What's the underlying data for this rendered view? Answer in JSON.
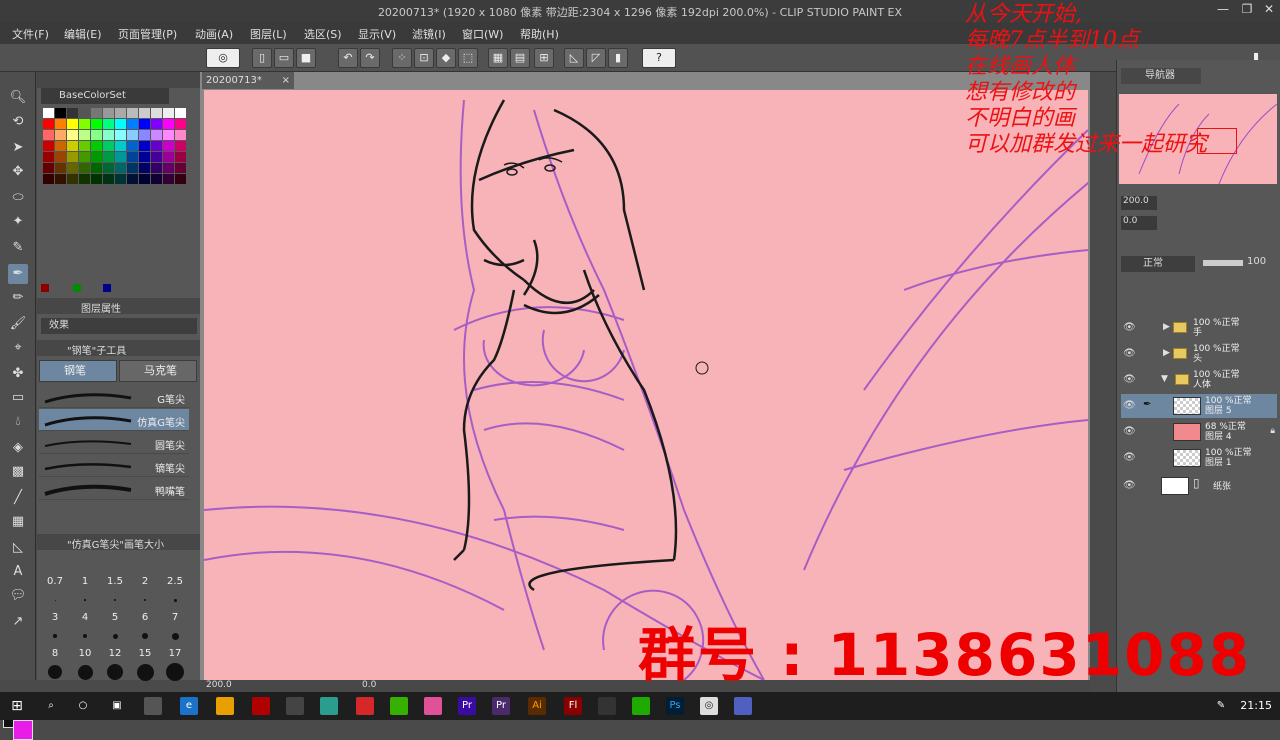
{
  "window": {
    "title": "20200713* (1920 x 1080 像素 带边距:2304 x 1296 像素 192dpi 200.0%) - CLIP STUDIO PAINT EX",
    "minimize": "—",
    "maximize": "❐",
    "close": "✕"
  },
  "menu": [
    "文件(F)",
    "编辑(E)",
    "页面管理(P)",
    "动画(A)",
    "图层(L)",
    "选区(S)",
    "显示(V)",
    "滤镜(I)",
    "窗口(W)",
    "帮助(H)"
  ],
  "canvas_tab": {
    "label": "20200713*",
    "close": "×"
  },
  "color_set": {
    "name": "BaseColorSet"
  },
  "panel_tabs": {
    "layer_property": "图层属性",
    "effect": "效果"
  },
  "sub_tool": {
    "header": "\"钢笔\"子工具",
    "tabs": [
      "钢笔",
      "马克笔"
    ],
    "brushes": [
      "G笔尖",
      "仿真G笔尖",
      "圆笔尖",
      "镝笔尖",
      "鸭嘴笔"
    ]
  },
  "brush_size": {
    "header": "\"仿真G笔尖\"画笔大小",
    "sizes": [
      "0.7",
      "1",
      "1.5",
      "2",
      "2.5",
      "3",
      "4",
      "5",
      "6",
      "7",
      "8",
      "10",
      "12",
      "15",
      "17"
    ]
  },
  "status": {
    "zoom": "200.0",
    "angle": "0.0"
  },
  "navigator": {
    "tab": "导航器",
    "zoom": "200.0",
    "rotate": "0.0"
  },
  "layers": {
    "blend_mode": "正常",
    "opacity": "100",
    "rows": [
      {
        "pct": "100 %正常",
        "name": "手",
        "type": "folder"
      },
      {
        "pct": "100 %正常",
        "name": "头",
        "type": "folder"
      },
      {
        "pct": "100 %正常",
        "name": "人体",
        "type": "folder"
      },
      {
        "pct": "100 %正常",
        "name": "图层 5",
        "type": "layer"
      },
      {
        "pct": "68 %正常",
        "name": "图层 4",
        "type": "layer"
      },
      {
        "pct": "100 %正常",
        "name": "图层 1",
        "type": "layer"
      },
      {
        "pct": "",
        "name": "纸张",
        "type": "paper"
      }
    ]
  },
  "overlay": {
    "lines": [
      "从今天开始,",
      "每晚7点半到10点",
      "在线画人体",
      "想有修改的",
      "不明白的画",
      "可以加群发过来一起研究"
    ],
    "group_number": "群号 : 1138631088"
  },
  "taskbar": {
    "time": "21:15"
  },
  "colors": {
    "canvas": "#f7b3b7",
    "sketch": "#9b4fc9",
    "ink": "#1a1a1a",
    "overlay_text": "#e11111",
    "foreground": "#111111",
    "background": "#e81de8"
  }
}
